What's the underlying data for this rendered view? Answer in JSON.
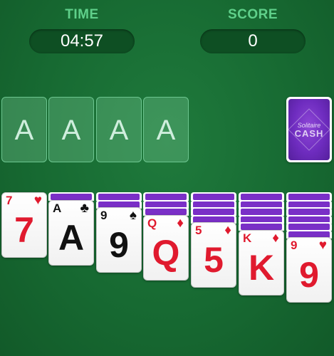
{
  "hud": {
    "time_label": "TIME",
    "time_value": "04:57",
    "score_label": "SCORE",
    "score_value": "0"
  },
  "foundations": [
    {
      "label": "A"
    },
    {
      "label": "A"
    },
    {
      "label": "A"
    },
    {
      "label": "A"
    }
  ],
  "stock": {
    "logo_top": "Solitaire",
    "logo_bottom": "CASH"
  },
  "tableau": [
    {
      "face_down": 0,
      "card": {
        "rank": "7",
        "suit": "♥",
        "color": "red"
      }
    },
    {
      "face_down": 1,
      "card": {
        "rank": "A",
        "suit": "♣",
        "color": "black"
      }
    },
    {
      "face_down": 2,
      "card": {
        "rank": "9",
        "suit": "♠",
        "color": "black"
      }
    },
    {
      "face_down": 3,
      "card": {
        "rank": "Q",
        "suit": "♦",
        "color": "red"
      }
    },
    {
      "face_down": 4,
      "card": {
        "rank": "5",
        "suit": "♦",
        "color": "red"
      }
    },
    {
      "face_down": 5,
      "card": {
        "rank": "K",
        "suit": "♦",
        "color": "red"
      }
    },
    {
      "face_down": 6,
      "card": {
        "rank": "9",
        "suit": "♥",
        "color": "red"
      }
    }
  ],
  "colors": {
    "felt": "#176a32",
    "hud_label": "#5fd08a",
    "card_back": "#7a2fc7",
    "red_suit": "#e01a2e",
    "black_suit": "#111111"
  }
}
